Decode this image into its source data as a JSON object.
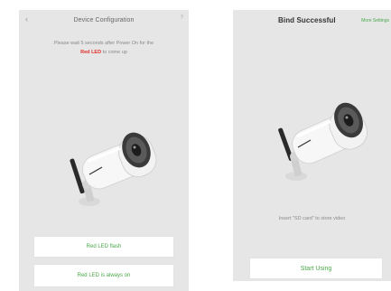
{
  "left_screen": {
    "back_icon": "chevron-left",
    "title": "Device Configuration",
    "help_icon": "question-mark",
    "instruction_before": "Please wait 5 seconds after Power On for the",
    "instruction_red": "Red LED",
    "instruction_after": "to come up",
    "buttons": {
      "flash": "Red LED flash",
      "always_on": "Red LED is always on"
    }
  },
  "right_screen": {
    "title": "Bind Successful",
    "more_link": "More Settings",
    "hint": "Insert \"SD card\" to store video",
    "start_button": "Start Using"
  },
  "colors": {
    "accent": "#4aa84a",
    "led_red": "#e0302a",
    "screen_bg": "#e6e6e6"
  }
}
